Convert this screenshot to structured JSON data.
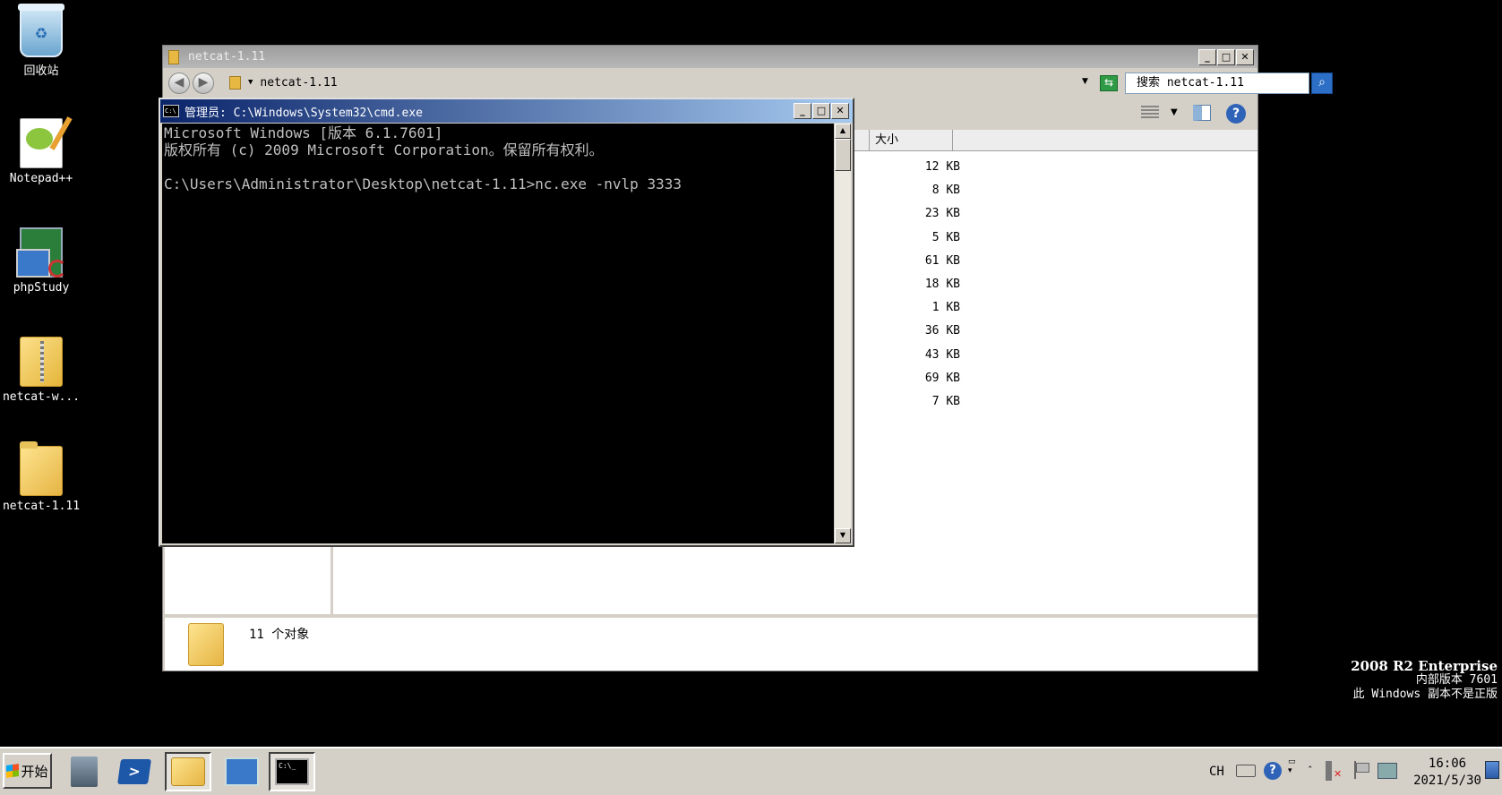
{
  "desktop": {
    "icons": [
      {
        "label": "回收站",
        "icon": "recycle-bin-icon"
      },
      {
        "label": "Notepad++",
        "icon": "notepad-plus-plus-icon"
      },
      {
        "label": "phpStudy",
        "icon": "phpstudy-icon"
      },
      {
        "label": "netcat-w...",
        "icon": "zip-folder-icon"
      },
      {
        "label": "netcat-1.11",
        "icon": "folder-icon"
      }
    ]
  },
  "explorer": {
    "title": "netcat-1.11",
    "address": "netcat-1.11",
    "search_placeholder": "搜索 netcat-1.11",
    "column_size": "大小",
    "sizes": [
      "12 KB",
      "8 KB",
      "23 KB",
      "5 KB",
      "61 KB",
      "18 KB",
      "1 KB",
      "36 KB",
      "43 KB",
      "69 KB",
      "7 KB"
    ],
    "status": "11 个对象",
    "minimize": "_",
    "maximize": "□",
    "close": "✕"
  },
  "cmd": {
    "title": "管理员: C:\\Windows\\System32\\cmd.exe",
    "lines": [
      "Microsoft Windows [版本 6.1.7601]",
      "版权所有 (c) 2009 Microsoft Corporation。保留所有权利。",
      "",
      "C:\\Users\\Administrator\\Desktop\\netcat-1.11>nc.exe -nvlp 3333"
    ],
    "minimize": "_",
    "maximize": "□",
    "close": "✕"
  },
  "watermark": {
    "line1": "2008 R2 Enterprise",
    "line2": "内部版本 7601",
    "line3": "此 Windows 副本不是正版"
  },
  "taskbar": {
    "start_label": "开始",
    "lang": "CH",
    "help": "?",
    "time": "16:06",
    "date": "2021/5/30"
  },
  "colors": {
    "desktop_bg": "#000000",
    "cmd_title_start": "#0a246a",
    "cmd_title_end": "#a6caf0",
    "console_text": "#c0c0c0"
  }
}
